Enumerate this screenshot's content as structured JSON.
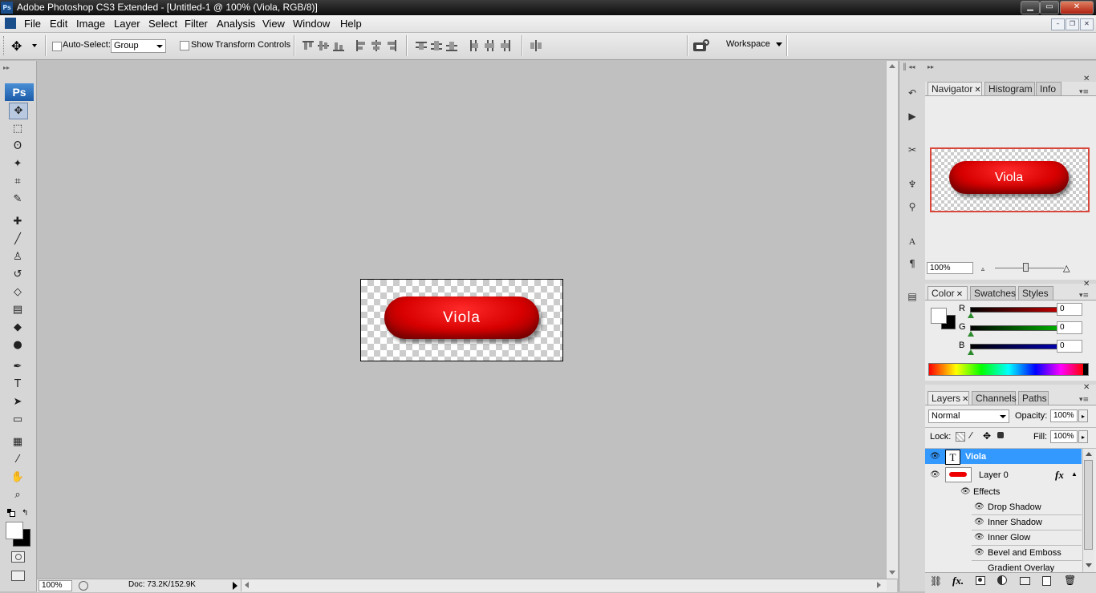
{
  "window": {
    "title": "Adobe Photoshop CS3 Extended - [Untitled-1 @ 100% (Viola, RGB/8)]",
    "app_icon": "Ps",
    "minimize": "▁",
    "maximize": "▭",
    "close": "✕"
  },
  "menu": {
    "items": [
      "File",
      "Edit",
      "Image",
      "Layer",
      "Select",
      "Filter",
      "Analysis",
      "View",
      "Window",
      "Help"
    ],
    "mdi": [
      "–",
      "❐",
      "✕"
    ]
  },
  "options": {
    "auto_select_label": "Auto-Select:",
    "auto_select_value": "Group",
    "show_transform_label": "Show Transform Controls",
    "workspace_label": "Workspace"
  },
  "toolbox": {
    "logo": "Ps",
    "tools": [
      {
        "name": "move-tool",
        "glyph": "✥"
      },
      {
        "name": "marquee-tool",
        "glyph": "⬚"
      },
      {
        "name": "lasso-tool",
        "glyph": "ʘ"
      },
      {
        "name": "magic-wand-tool",
        "glyph": "✦"
      },
      {
        "name": "crop-tool",
        "glyph": "⌗"
      },
      {
        "name": "slice-tool",
        "glyph": "✎"
      },
      {
        "name": "healing-brush-tool",
        "glyph": "✚"
      },
      {
        "name": "brush-tool",
        "glyph": "╱"
      },
      {
        "name": "clone-stamp-tool",
        "glyph": "♙"
      },
      {
        "name": "history-brush-tool",
        "glyph": "↺"
      },
      {
        "name": "eraser-tool",
        "glyph": "◇"
      },
      {
        "name": "gradient-tool",
        "glyph": "▤"
      },
      {
        "name": "blur-tool",
        "glyph": "◆"
      },
      {
        "name": "dodge-tool",
        "glyph": "●"
      },
      {
        "name": "pen-tool",
        "glyph": "✒"
      },
      {
        "name": "type-tool",
        "glyph": "T"
      },
      {
        "name": "path-selection-tool",
        "glyph": "➤"
      },
      {
        "name": "shape-tool",
        "glyph": "▭"
      },
      {
        "name": "notes-tool",
        "glyph": "▦"
      },
      {
        "name": "eyedropper-tool",
        "glyph": "⁄"
      },
      {
        "name": "hand-tool",
        "glyph": "✋"
      },
      {
        "name": "zoom-tool",
        "glyph": "⌕"
      }
    ]
  },
  "document": {
    "button_text": "Viola",
    "zoom": "100%",
    "doc_info": "Doc: 73.2K/152.9K"
  },
  "navigator": {
    "tabs": [
      "Navigator",
      "Histogram",
      "Info"
    ],
    "preview_text": "Viola",
    "zoom": "100%"
  },
  "color": {
    "tabs": [
      "Color",
      "Swatches",
      "Styles"
    ],
    "channels": [
      {
        "label": "R",
        "value": "0",
        "color": "#cc0000"
      },
      {
        "label": "G",
        "value": "0",
        "color": "#00bb00"
      },
      {
        "label": "B",
        "value": "0",
        "color": "#0000bb"
      }
    ]
  },
  "layers": {
    "tabs": [
      "Layers",
      "Channels",
      "Paths"
    ],
    "blend_mode": "Normal",
    "opacity_label": "Opacity:",
    "opacity": "100%",
    "lock_label": "Lock:",
    "fill_label": "Fill:",
    "fill": "100%",
    "text_layer": "Viola",
    "image_layer": "Layer 0",
    "effects_label": "Effects",
    "effects": [
      "Drop Shadow",
      "Inner Shadow",
      "Inner Glow",
      "Bevel and Emboss",
      "Gradient Overlay"
    ],
    "fx": "fx"
  }
}
